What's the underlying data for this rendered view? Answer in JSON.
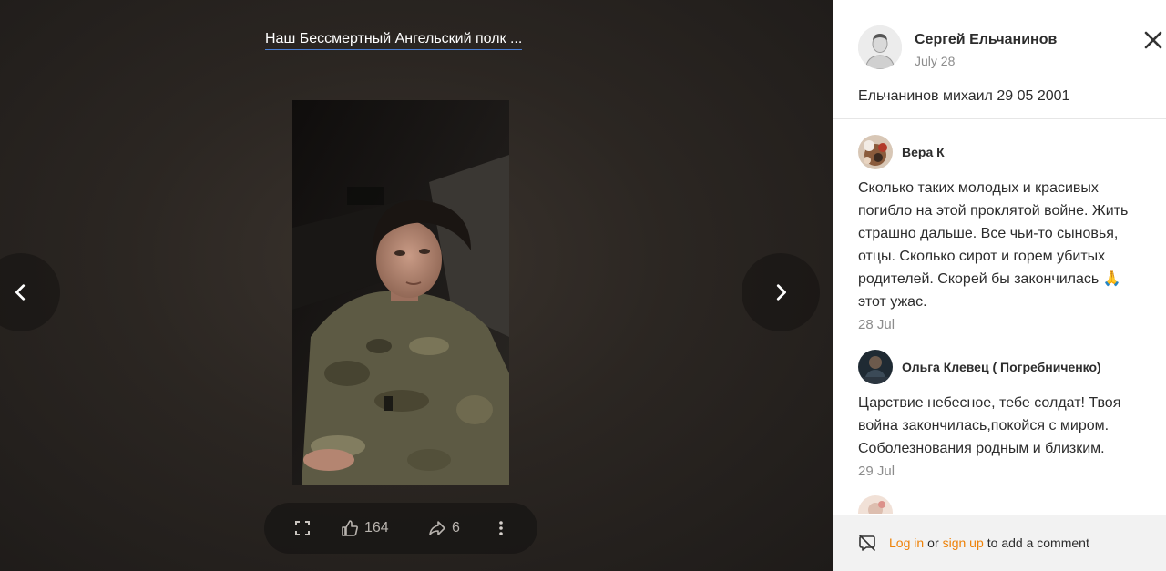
{
  "viewer": {
    "album_title": "Наш Бессмертный Ангельский полк ...",
    "likes": "164",
    "shares": "6"
  },
  "panel": {
    "author_name": "Сергей Ельчанинов",
    "author_date": "July 28",
    "description": "Ельчанинов михаил 29 05 2001",
    "comments": [
      {
        "name": "Вера К",
        "text": "Сколько таких молодых и красивых погибло на этой проклятой войне. Жить страшно дальше. Все чьи-то сыновья, отцы. Сколько сирот и горем убитых родителей. Скорей бы закончилась 🙏 этот ужас.",
        "date": "28 Jul"
      },
      {
        "name": "Ольга Клевец ( Погребниченко)",
        "text": "Царствие небесное, тебе солдат! Твоя война закончилась,покойся с миром. Соболезнования родным и близким.",
        "date": "29 Jul"
      }
    ],
    "footer": {
      "login": "Log in",
      "or": "or",
      "signup": "sign up",
      "suffix": "to add a comment"
    }
  },
  "colors": {
    "accent": "#ee8208",
    "album_underline": "#4a7fd6"
  },
  "icons": [
    "chevron-left-icon",
    "chevron-right-icon",
    "fullscreen-icon",
    "thumbs-up-icon",
    "share-icon",
    "more-vertical-icon",
    "close-icon",
    "comments-disabled-icon"
  ]
}
